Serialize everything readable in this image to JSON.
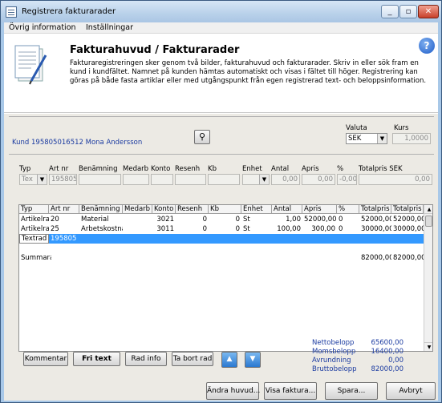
{
  "window": {
    "title": "Registrera fakturarader"
  },
  "menu": [
    "Övrig information",
    "Inställningar"
  ],
  "header": {
    "title": "Fakturahuvud / Fakturarader",
    "text": "Fakturaregistreringen sker genom två bilder, fakturahuvud och fakturarader. Skriv in eller sök fram en kund i kundfältet. Namnet på kunden hämtas automatiskt och visas i fältet till höger. Registrering kan göras på både fasta artiklar eller med utgångspunkt från egen registrerad text- och beloppsinformation."
  },
  "customer": "Kund 195805016512 Mona Andersson",
  "valuta": {
    "label": "Valuta",
    "value": "SEK"
  },
  "kurs": {
    "label": "Kurs",
    "value": "1,0000"
  },
  "entry": {
    "labels": [
      "Typ",
      "Art nr",
      "Benämning",
      "Medarb",
      "Konto",
      "Resenh",
      "Kb",
      "Enhet",
      "Antal",
      "Apris",
      "%",
      "Totalpris SEK"
    ],
    "typ": "Tex",
    "artnr": "195805",
    "antal": "0,00",
    "apris": "0,00",
    "pct": "-0,00",
    "total": "0,00"
  },
  "grid": {
    "headers": [
      "Typ",
      "Art nr",
      "Benämning",
      "Medarb",
      "Konto",
      "Resenh",
      "Kb",
      "Enhet",
      "Antal",
      "Apris",
      "%",
      "Totalpris",
      "Totalpris"
    ],
    "rows": [
      [
        "Artikelrad",
        "20",
        "Material",
        "",
        "3021",
        "0",
        "0",
        "St",
        "1,00",
        "52000,00",
        "0",
        "52000,00",
        "52000,00"
      ],
      [
        "Artikelrad",
        "25",
        "Arbetskostnad",
        "",
        "3011",
        "0",
        "0",
        "St",
        "100,00",
        "300,00",
        "0",
        "30000,00",
        "30000,00"
      ],
      [
        "Textrad",
        "195805",
        "",
        "",
        "",
        "",
        "",
        "",
        "",
        "",
        "",
        "",
        ""
      ]
    ],
    "summary": {
      "label": "Summarad",
      "total1": "82000,00",
      "total2": "82000,00"
    }
  },
  "buttons": {
    "kommentar": "Kommentar",
    "fritext": "Fri text",
    "radinfo": "Rad info",
    "tabort": "Ta bort rad",
    "andra": "Ändra huvud...",
    "visa": "Visa faktura...",
    "spara": "Spara...",
    "avbryt": "Avbryt"
  },
  "totals": [
    {
      "label": "Nettobelopp",
      "value": "65600,00"
    },
    {
      "label": "Momsbelopp",
      "value": "16400,00"
    },
    {
      "label": "Avrundning",
      "value": "0,00"
    },
    {
      "label": "Bruttobelopp",
      "value": "82000,00"
    }
  ],
  "colors": {
    "accent": "#3399ff",
    "link": "#1a3aa0"
  }
}
